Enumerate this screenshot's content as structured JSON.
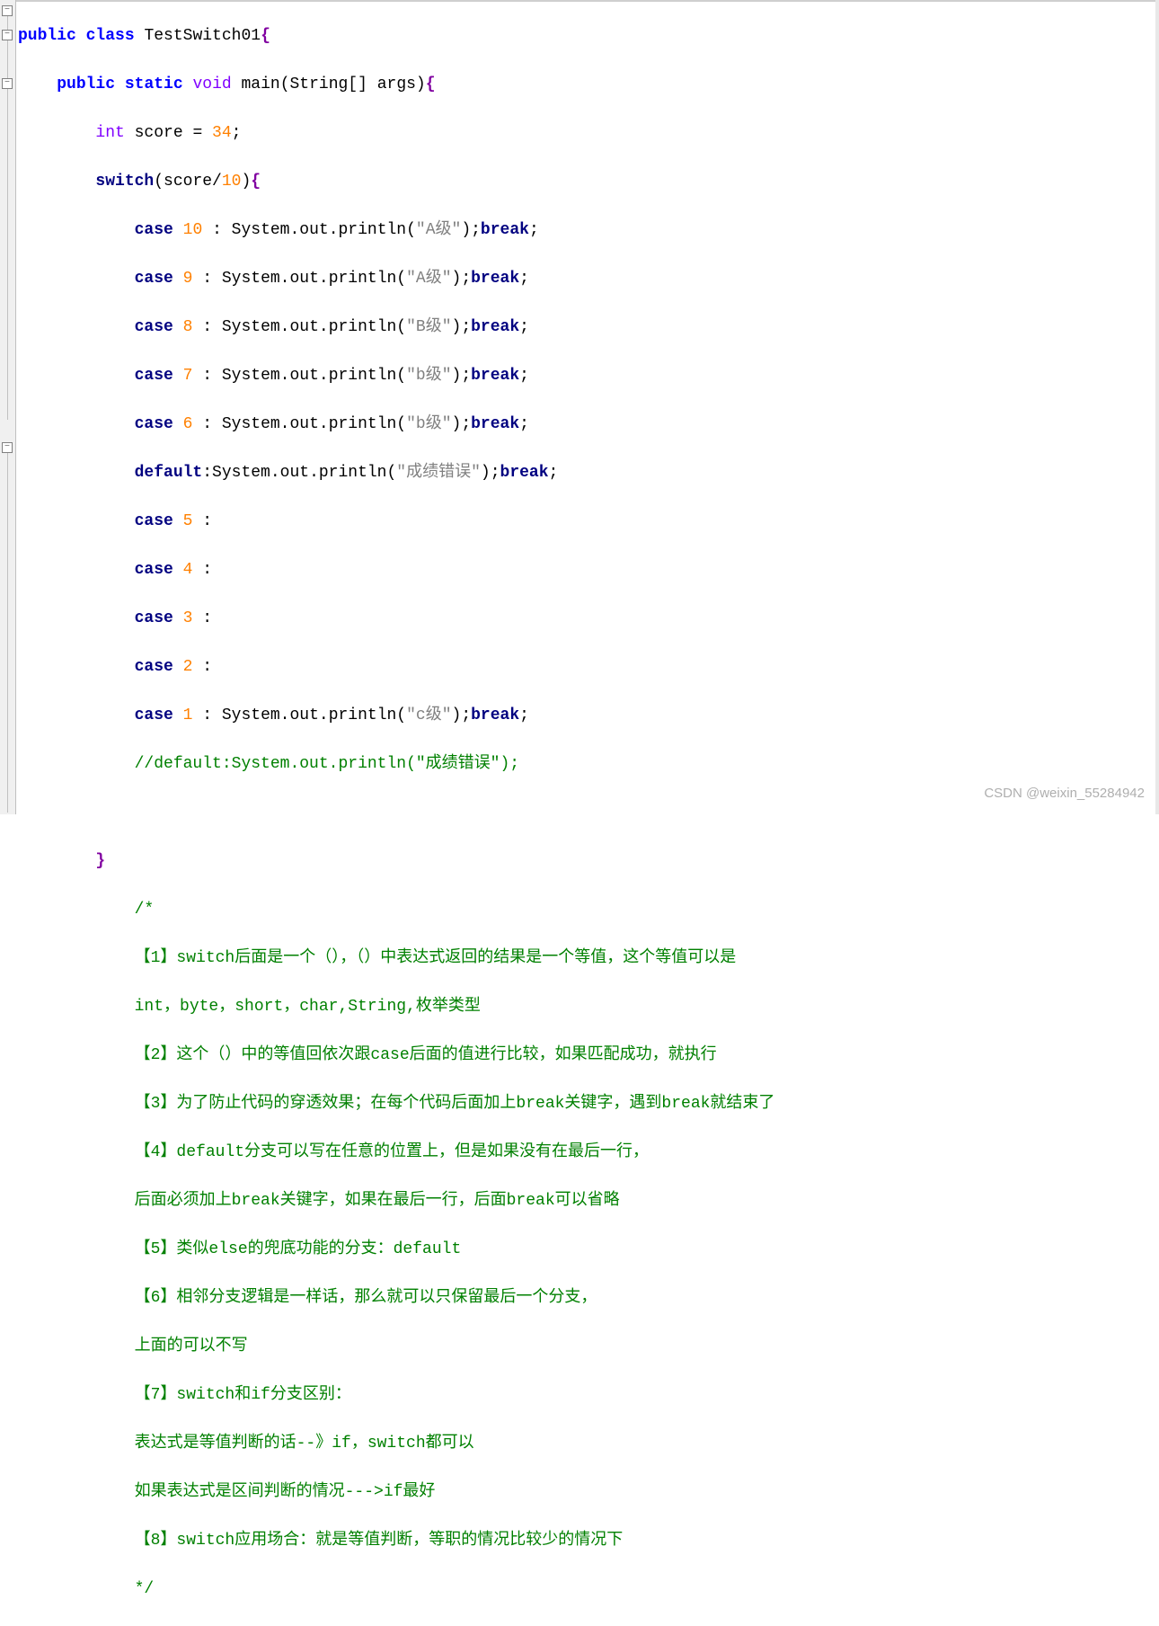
{
  "code": {
    "line01": {
      "a": "public",
      "b": " ",
      "c": "class",
      "d": " TestSwitch01",
      "e": "{"
    },
    "line02": {
      "a": "    ",
      "b": "public",
      "c": " ",
      "d": "static",
      "e": " ",
      "f": "void",
      "g": " main(String[] args)",
      "h": "{"
    },
    "line03": {
      "a": "        ",
      "b": "int",
      "c": " score = ",
      "d": "34",
      "e": ";"
    },
    "line04": {
      "a": "        ",
      "b": "switch",
      "c": "(score/",
      "d": "10",
      "e": ")",
      "f": "{"
    },
    "line05": {
      "a": "            ",
      "b": "case",
      "c": " ",
      "d": "10",
      "e": " : System.out.println(",
      "f": "\"A级\"",
      "g": ");",
      "h": "break",
      "i": ";"
    },
    "line06": {
      "a": "            ",
      "b": "case",
      "c": " ",
      "d": "9",
      "e": " : System.out.println(",
      "f": "\"A级\"",
      "g": ");",
      "h": "break",
      "i": ";"
    },
    "line07": {
      "a": "            ",
      "b": "case",
      "c": " ",
      "d": "8",
      "e": " : System.out.println(",
      "f": "\"B级\"",
      "g": ");",
      "h": "break",
      "i": ";"
    },
    "line08": {
      "a": "            ",
      "b": "case",
      "c": " ",
      "d": "7",
      "e": " : System.out.println(",
      "f": "\"b级\"",
      "g": ");",
      "h": "break",
      "i": ";"
    },
    "line09": {
      "a": "            ",
      "b": "case",
      "c": " ",
      "d": "6",
      "e": " : System.out.println(",
      "f": "\"b级\"",
      "g": ");",
      "h": "break",
      "i": ";"
    },
    "line10": {
      "a": "            ",
      "b": "default",
      "c": ":System.out.println(",
      "d": "\"成绩错误\"",
      "e": ");",
      "f": "break",
      "g": ";"
    },
    "line11": {
      "a": "            ",
      "b": "case",
      "c": " ",
      "d": "5",
      "e": " :"
    },
    "line12": {
      "a": "            ",
      "b": "case",
      "c": " ",
      "d": "4",
      "e": " :"
    },
    "line13": {
      "a": "            ",
      "b": "case",
      "c": " ",
      "d": "3",
      "e": " :"
    },
    "line14": {
      "a": "            ",
      "b": "case",
      "c": " ",
      "d": "2",
      "e": " :"
    },
    "line15": {
      "a": "            ",
      "b": "case",
      "c": " ",
      "d": "1",
      "e": " : System.out.println(",
      "f": "\"c级\"",
      "g": ");",
      "h": "break",
      "i": ";"
    },
    "line16": {
      "a": "            ",
      "b": "//default:System.out.println(\"成绩错误\");"
    },
    "line18": {
      "a": "        ",
      "b": "}"
    },
    "comment_lines": [
      "            /*",
      "            【1】switch后面是一个（），（）中表达式返回的结果是一个等值，这个等值可以是",
      "            int，byte，short，char,String,枚举类型",
      "            【2】这个（）中的等值回依次跟case后面的值进行比较，如果匹配成功，就执行",
      "            【3】为了防止代码的穿透效果；在每个代码后面加上break关键字，遇到break就结束了",
      "            【4】default分支可以写在任意的位置上，但是如果没有在最后一行，",
      "            后面必须加上break关键字，如果在最后一行，后面break可以省略",
      "            【5】类似else的兜底功能的分支：default",
      "            【6】相邻分支逻辑是一样话，那么就可以只保留最后一个分支，",
      "            上面的可以不写",
      "            【7】switch和if分支区别：",
      "            表达式是等值判断的话--》if，switch都可以",
      "            如果表达式是区间判断的情况--->if最好",
      "            【8】switch应用场合：就是等值判断，等职的情况比较少的情况下",
      "            */"
    ]
  },
  "watermark": "CSDN @weixin_55284942"
}
